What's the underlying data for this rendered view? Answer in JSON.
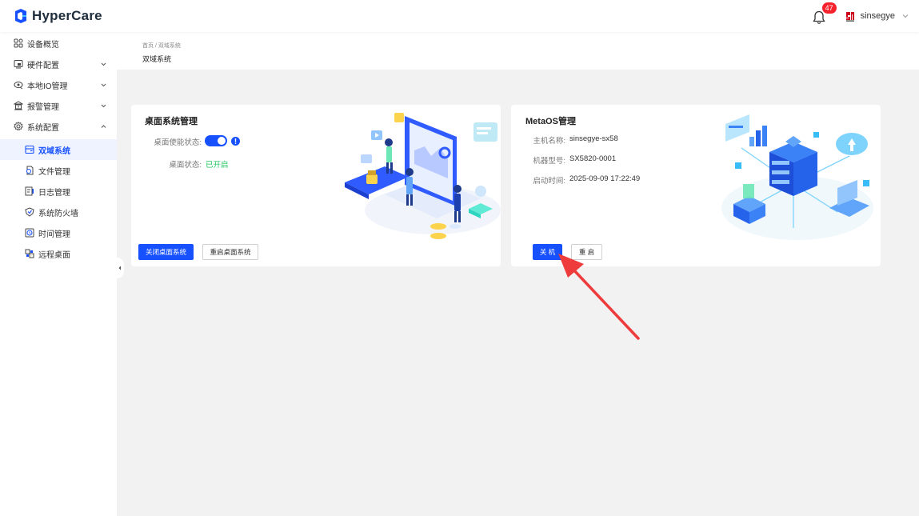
{
  "header": {
    "logo_text": "HyperCare",
    "notification_count": "47",
    "username": "sinsegye"
  },
  "sidebar": {
    "items": [
      {
        "label": "设备概览",
        "icon": "grid-icon",
        "has_arrow": false
      },
      {
        "label": "硬件配置",
        "icon": "hardware-icon",
        "has_arrow": true
      },
      {
        "label": "本地IO管理",
        "icon": "io-icon",
        "has_arrow": true
      },
      {
        "label": "报警管理",
        "icon": "alarm-icon",
        "has_arrow": true
      },
      {
        "label": "系统配置",
        "icon": "settings-icon",
        "has_arrow": true,
        "expanded": true
      },
      {
        "label": "双域系统",
        "icon": "dual-domain-icon",
        "active": true
      },
      {
        "label": "文件管理",
        "icon": "file-icon"
      },
      {
        "label": "日志管理",
        "icon": "log-icon"
      },
      {
        "label": "系统防火墙",
        "icon": "firewall-icon"
      },
      {
        "label": "时间管理",
        "icon": "clock-icon"
      },
      {
        "label": "远程桌面",
        "icon": "remote-desktop-icon"
      }
    ]
  },
  "breadcrumb": {
    "path": "首页 / 双域系统",
    "title": "双域系统"
  },
  "desktop_card": {
    "title": "桌面系统管理",
    "enable_label": "桌面使能状态:",
    "enable_on": true,
    "status_label": "桌面状态:",
    "status_value": "已开启",
    "close_button": "关闭桌面系统",
    "restart_button": "重启桌面系统"
  },
  "metaos_card": {
    "title": "MetaOS管理",
    "host_label": "主机名称:",
    "host_value": "sinsegye-sx58",
    "model_label": "机器型号:",
    "model_value": "SX5820-0001",
    "boot_label": "启动时间:",
    "boot_value": "2025-09-09 17:22:49",
    "shutdown_button": "关 机",
    "restart_button": "重 启"
  },
  "colors": {
    "primary": "#1650ff",
    "success": "#22c55e",
    "badge": "#f5222d",
    "annotation_arrow": "#ee3b3b"
  }
}
